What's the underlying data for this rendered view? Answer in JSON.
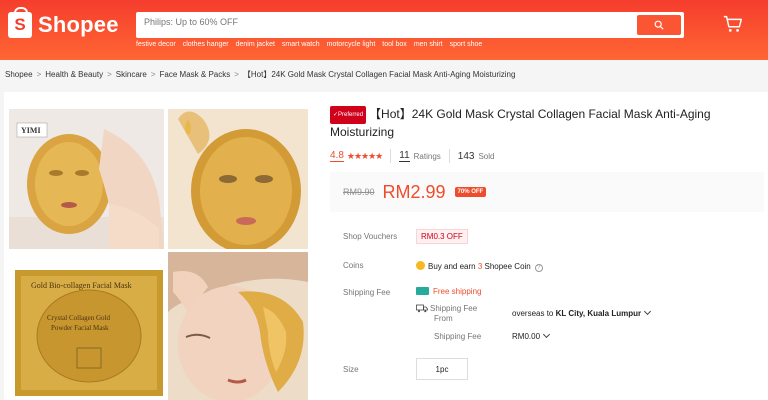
{
  "header": {
    "logo_text": "Shopee",
    "logo_letter": "S",
    "search_placeholder": "Philips: Up to 60% OFF",
    "keywords": [
      "festive decor",
      "clothes hanger",
      "denim jacket",
      "smart watch",
      "motorcycle light",
      "tool box",
      "men shirt",
      "sport shoe"
    ],
    "icons": {
      "search": "search-icon",
      "cart": "cart-icon"
    },
    "colors": {
      "brand": "#f53d2d",
      "accent": "#ee4d2d"
    }
  },
  "breadcrumb": [
    "Shopee",
    "Health & Beauty",
    "Skincare",
    "Face Mask & Packs",
    "【Hot】24K Gold Mask Crystal Collagen Facial Mask Anti-Aging Moisturizing"
  ],
  "product": {
    "badge": "✓Preferred",
    "title": "【Hot】24K Gold Mask Crystal Collagen Facial Mask Anti-Aging Moisturizing",
    "rating": "4.8",
    "stars": "★★★★★",
    "ratings_count": "11",
    "ratings_label": "Ratings",
    "sold_count": "143",
    "sold_label": "Sold",
    "old_price": "RM9.90",
    "price": "RM2.99",
    "discount": "70% OFF"
  },
  "details": {
    "vouchers_label": "Shop Vouchers",
    "voucher_value": "RM0.3 OFF",
    "coins_label": "Coins",
    "coins_text_a": "Buy and earn ",
    "coins_amount": "3",
    "coins_text_b": " Shopee Coin",
    "shipping_label": "Shipping Fee",
    "free_shipping": "Free shipping",
    "ship_from_label_a": "Shipping Fee",
    "ship_from_label_b": "From",
    "ship_from_text": "overseas",
    "ship_to": "to",
    "ship_destination": "KL City, Kuala Lumpur",
    "ship_fee_label": "Shipping Fee",
    "ship_fee_value": "RM0.00",
    "size_label": "Size",
    "size_option": "1pc"
  },
  "gallery": {
    "image_labels": [
      "YIMI",
      "Gold Bio-collagen Facial Mask",
      "Crystal Collagen Gold",
      "Powder Facial Mask"
    ]
  }
}
